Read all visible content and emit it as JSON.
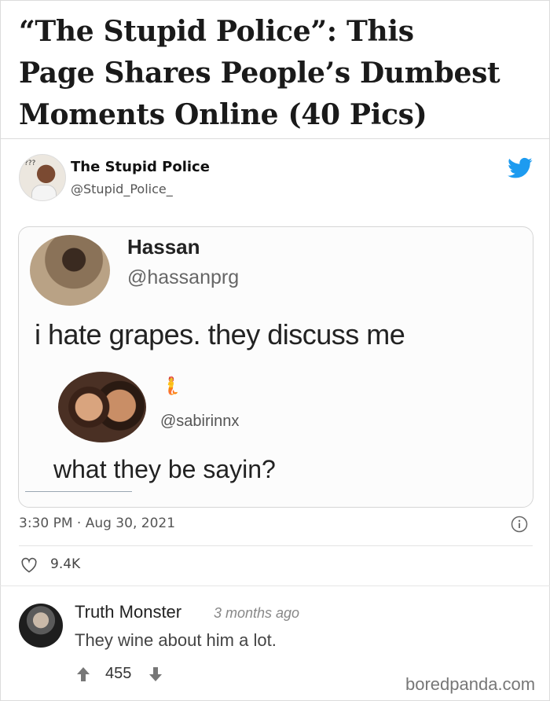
{
  "article": {
    "title_lines": [
      "“The Stupid Police”: This",
      "Page Shares People’s Dumbest",
      "Moments Online (40 Pics)"
    ]
  },
  "tweet": {
    "author_name": "The Stupid Police",
    "author_handle": "@Stupid_Police_",
    "avatar_caption": "???",
    "timestamp": "3:30 PM · Aug 30, 2021",
    "likes": "9.4K",
    "icons": {
      "brand": "twitter-bird-icon",
      "info": "info-icon",
      "like": "heart-icon"
    },
    "colors": {
      "twitter_blue": "#1d9bf0"
    }
  },
  "screenshot": {
    "post_name": "Hassan",
    "post_handle": "@hassanprg",
    "post_text": "i hate grapes. they discuss me",
    "reply_handle": "@sabirinnx",
    "reply_name_emoji": "🧜",
    "reply_text": "what they be sayin?"
  },
  "comment": {
    "author": "Truth Monster",
    "time_ago": "3 months ago",
    "text": "They wine about him a lot.",
    "votes": "455"
  },
  "watermark": "boredpanda.com"
}
